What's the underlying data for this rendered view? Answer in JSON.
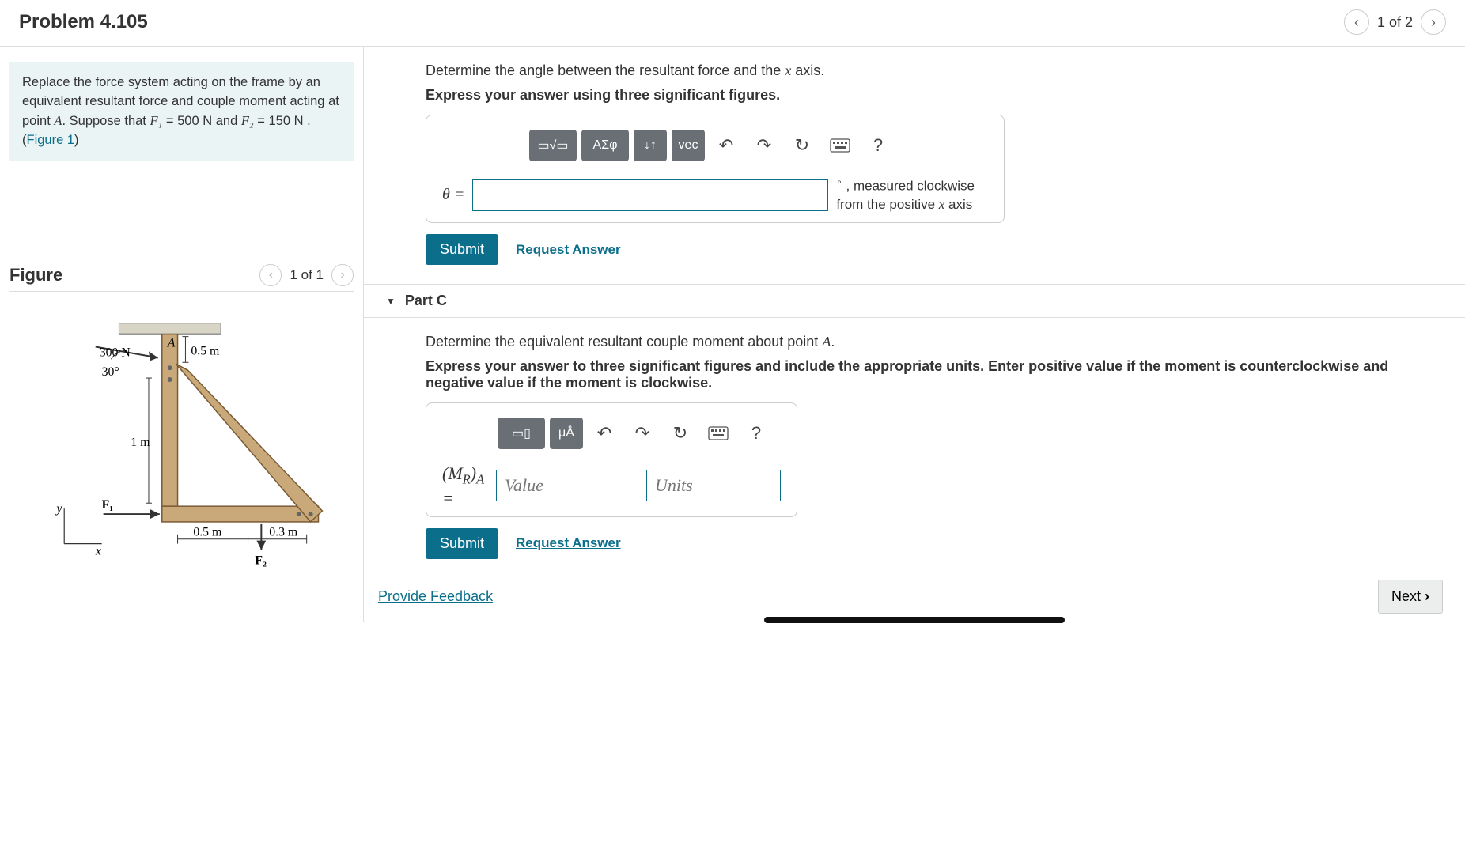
{
  "header": {
    "title": "Problem 4.105",
    "pager": "1 of 2"
  },
  "problem": {
    "text_pre": "Replace the force system acting on the frame by an equivalent resultant force and couple moment acting at point ",
    "pointA": "A",
    "text_mid1": ". Suppose that ",
    "F1lbl": "F₁",
    "F1val": " = 500  N ",
    "and": " and ",
    "F2lbl": "F₂",
    "F2val": " = 150  N .",
    "figlink_open": "(",
    "figlink": "Figure 1",
    "figlink_close": ")"
  },
  "figure_section": {
    "title": "Figure",
    "pager": "1 of 1"
  },
  "figure_labels": {
    "A": "A",
    "load": "300 N",
    "dim05top": "0.5 m",
    "angle": "30°",
    "dim1m": "1 m",
    "F1": "F₁",
    "y": "y",
    "x": "x",
    "dim05bot": "0.5 m",
    "dim03": "0.3 m",
    "F2": "F₂"
  },
  "partB": {
    "prompt_pre": "Determine the angle between the resultant force and the ",
    "x": "x",
    "prompt_post": " axis.",
    "hint": "Express your answer using three significant figures.",
    "toolbar": {
      "templates": "▭√▭",
      "greek": "ΑΣφ",
      "updown": "↓↑",
      "vec": "vec"
    },
    "theta": "θ =",
    "unit_line1": " , measured clockwise",
    "unit_line2_pre": "from the positive ",
    "unit_line2_x": "x",
    "unit_line2_post": " axis",
    "submit": "Submit",
    "request": "Request Answer"
  },
  "partC": {
    "title": "Part C",
    "prompt_pre": "Determine the equivalent resultant couple moment about point ",
    "A": "A",
    "prompt_post": ".",
    "hint": "Express your answer to three significant figures and include the appropriate units. Enter positive value if the moment is counterclockwise and negative value if the moment is clockwise.",
    "toolbar": {
      "templates": "▭▯",
      "units": "μÅ"
    },
    "label": "(M_R)_A =",
    "value_placeholder": "Value",
    "units_placeholder": "Units",
    "submit": "Submit",
    "request": "Request Answer"
  },
  "footer": {
    "feedback": "Provide Feedback",
    "next": "Next"
  }
}
